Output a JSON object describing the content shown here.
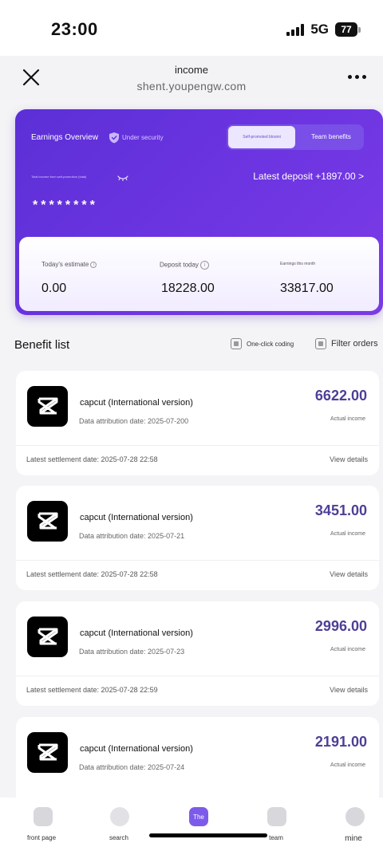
{
  "status_bar": {
    "time": "23:00",
    "network": "5G",
    "battery": "77"
  },
  "nav": {
    "title": "income",
    "url": "shent.youpengw.com"
  },
  "earnings_card": {
    "title": "Earnings Overview",
    "security_label": "Under security",
    "tabs": [
      {
        "label": "Self-promoted bloomi",
        "active": true
      },
      {
        "label": "Team benefits",
        "active": false
      }
    ],
    "tiny_caption": "Total income from self-promotion (total)",
    "masked_amount": "********",
    "latest_deposit": "Latest deposit +1897.00 >",
    "stats": [
      {
        "label": "Today's estimate",
        "value": "0.00"
      },
      {
        "label": "Deposit today",
        "value": "18228.00"
      },
      {
        "label": "Earnings this month",
        "value": "33817.00"
      }
    ]
  },
  "benefit_list": {
    "title": "Benefit list",
    "one_click_label": "One-click coding",
    "filter_label": "Filter orders",
    "items": [
      {
        "app_name": "capcut (International version)",
        "attribution_date": "Data attribution date: 2025-07-200",
        "amount": "6622.00",
        "amount_label": "Actual income",
        "settlement_date": "Latest settlement date: 2025-07-28 22:58",
        "details_label": "View details"
      },
      {
        "app_name": "capcut (International version)",
        "attribution_date": "Data attribution date: 2025-07-21",
        "amount": "3451.00",
        "amount_label": "Actual income",
        "settlement_date": "Latest settlement date: 2025-07-28 22:58",
        "details_label": "View details"
      },
      {
        "app_name": "capcut (International version)",
        "attribution_date": "Data attribution date: 2025-07-23",
        "amount": "2996.00",
        "amount_label": "Actual income",
        "settlement_date": "Latest settlement date: 2025-07-28 22:59",
        "details_label": "View details"
      },
      {
        "app_name": "capcut (International version)",
        "attribution_date": "Data attribution date: 2025-07-24",
        "amount": "2191.00",
        "amount_label": "Actual income"
      }
    ]
  },
  "tab_bar": {
    "tabs": [
      {
        "label": "front page",
        "icon": "home-icon"
      },
      {
        "label": "search",
        "icon": "search-icon"
      },
      {
        "label": "",
        "icon": "income-icon",
        "active_text": "The"
      },
      {
        "label": "team",
        "icon": "team-icon"
      },
      {
        "label": "mine",
        "icon": "profile-icon"
      }
    ]
  },
  "colors": {
    "accent": "#6a34e0",
    "amount": "#4e3f96",
    "background": "#f4f4f6"
  }
}
